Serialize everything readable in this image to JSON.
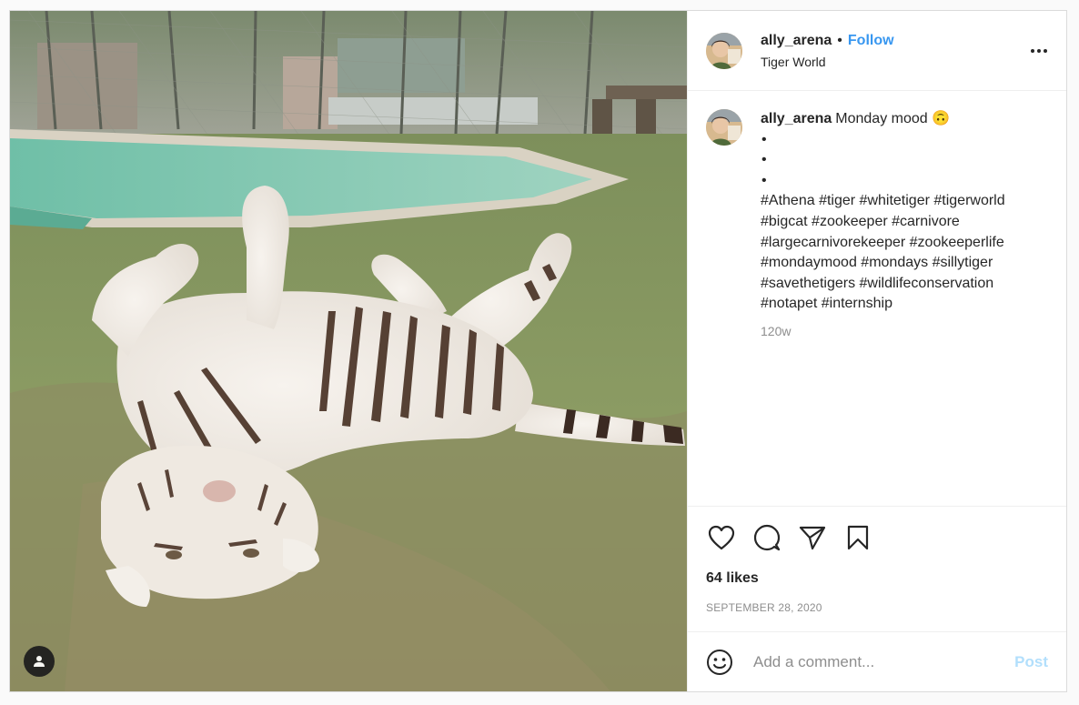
{
  "post": {
    "author": {
      "username": "ally_arena",
      "follow_label": "Follow",
      "separator": "•",
      "location": "Tiger World"
    },
    "caption": {
      "username": "ally_arena",
      "text": "Monday mood 🙃",
      "bullets": [
        "•",
        "•",
        "•"
      ],
      "hashtags": [
        "#Athena",
        "#tiger",
        "#whitetiger",
        "#tigerworld",
        "#bigcat",
        "#zookeeper",
        "#carnivore",
        "#largecarnivorekeeper",
        "#zookeeperlife",
        "#mondaymood",
        "#mondays",
        "#sillytiger",
        "#savethetigers",
        "#wildlifeconservation",
        "#notapet",
        "#internship"
      ],
      "time_ago": "120w"
    },
    "likes": "64 likes",
    "date": "SEPTEMBER 28, 2020",
    "comment_box": {
      "placeholder": "Add a comment...",
      "post_label": "Post"
    }
  },
  "icons": {
    "more": "more-options-icon",
    "like": "heart-icon",
    "comment": "comment-bubble-icon",
    "share": "paper-plane-icon",
    "save": "bookmark-icon",
    "emoji": "smiley-icon",
    "tag": "user-tag-icon"
  },
  "colors": {
    "link": "#3897f0",
    "post_disabled": "#b2dffc",
    "muted": "#8e8e8e",
    "text": "#262626"
  }
}
